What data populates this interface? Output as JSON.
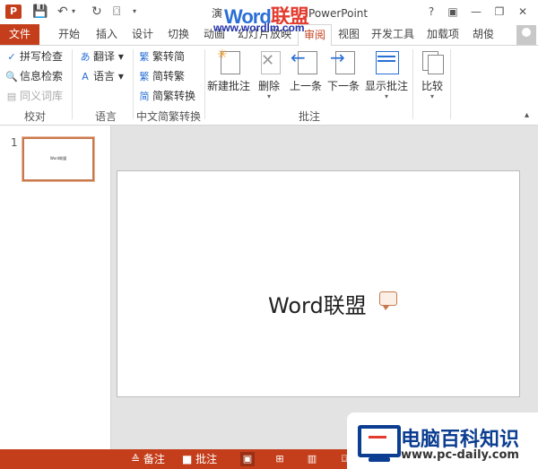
{
  "titlebar": {
    "app_icon": "P",
    "title_prefix": "演",
    "title_suffix": "PowerPoint",
    "help": "?",
    "ribbon_display": "▣",
    "minimize": "—",
    "restore": "❐",
    "close": "✕"
  },
  "watermark": {
    "logo_word": "Word",
    "logo_cn": "联盟",
    "url": "www.wordlm.com"
  },
  "tabs": {
    "file": "文件",
    "items": [
      "开始",
      "插入",
      "设计",
      "切换",
      "动画",
      "幻灯片放映",
      "审阅",
      "视图",
      "开发工具",
      "加载项"
    ],
    "user": "胡俊"
  },
  "ribbon": {
    "proofing": {
      "spell": "拼写检查",
      "research": "信息检索",
      "thesaurus": "同义词库",
      "label": "校对"
    },
    "language": {
      "translate": "翻译",
      "lang": "语言",
      "label": "语言"
    },
    "chinese": {
      "t2s": "繁转简",
      "s2t": "简转繁",
      "convert": "简繁转换",
      "label": "中文简繁转换"
    },
    "comments": {
      "new": "新建批注",
      "delete": "删除",
      "prev": "上一条",
      "next": "下一条",
      "show": "显示批注",
      "label": "批注"
    },
    "compare": {
      "label": "比较"
    }
  },
  "thumbnails": {
    "number": "1",
    "text": "Word联盟"
  },
  "slide": {
    "text": "Word联盟"
  },
  "statusbar": {
    "notes": "备注",
    "comments": "批注"
  },
  "corner": {
    "title": "电脑百科知识",
    "url": "www.pc-daily.com"
  },
  "colors": {
    "accent": "#c43e1c",
    "comment": "#c7794e"
  }
}
